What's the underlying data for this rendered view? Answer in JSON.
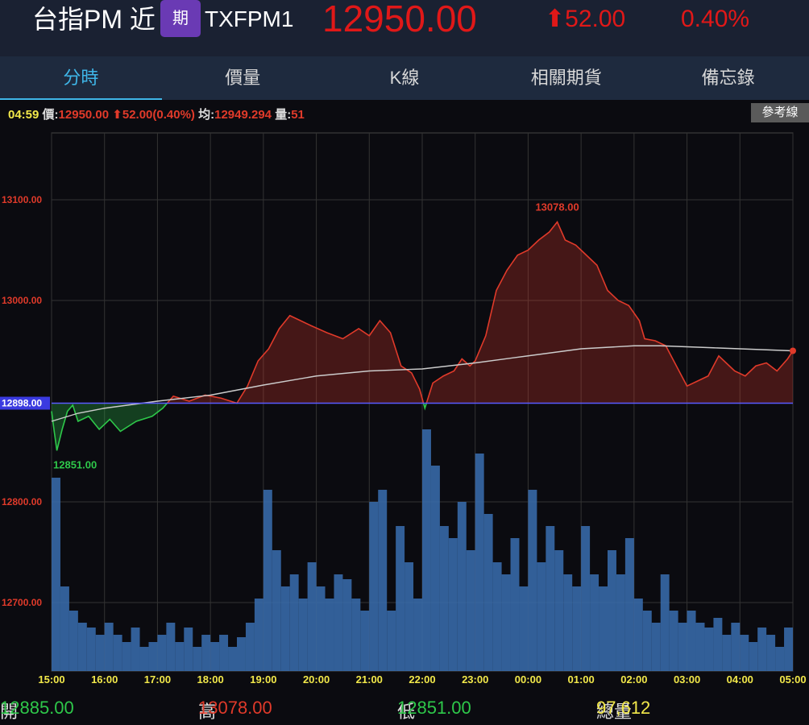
{
  "header": {
    "name": "台指PM 近",
    "badge": "期",
    "code": "TXFPM1",
    "price": "12950.00",
    "change": "52.00",
    "change_pct": "0.40%",
    "arrow_icon": "arrow-up-icon"
  },
  "tabs": [
    "分時",
    "價量",
    "K線",
    "相關期貨",
    "備忘錄"
  ],
  "info": {
    "time": "04:59",
    "price_label": "價:",
    "price": "12950.00",
    "change": "⬆52.00(0.40%)",
    "avg_label": "均:",
    "avg": "12949.294",
    "vol_label": "量:",
    "vol": "51"
  },
  "ref_button": "參考線",
  "footer": {
    "open_label": "開",
    "open": "12885.00",
    "high_label": "高",
    "high": "13078.00",
    "low_label": "低",
    "low": "12851.00",
    "vol_label": "總量",
    "vol": "97,612"
  },
  "colors": {
    "up": "#e03a2a",
    "down": "#2ec84a",
    "volume": "#3a6fb0",
    "avg": "#cccccc",
    "ref": "#5a5aff"
  },
  "chart_data": {
    "type": "line",
    "reference": 12898,
    "reference_label": "12898.00",
    "ylim": [
      12633,
      13165
    ],
    "y_ticks": [
      {
        "v": 13100,
        "label": "13100.00"
      },
      {
        "v": 13000,
        "label": "13000.00"
      },
      {
        "v": 12800,
        "label": "12800.00"
      },
      {
        "v": 12700,
        "label": "12700.00"
      }
    ],
    "x_ticks": [
      "15:00",
      "16:00",
      "17:00",
      "18:00",
      "19:00",
      "20:00",
      "21:00",
      "22:00",
      "23:00",
      "00:00",
      "01:00",
      "02:00",
      "03:00",
      "04:00",
      "05:00"
    ],
    "high_label": "13078.00",
    "low_label": "12851.00",
    "price": [
      [
        0,
        12890
      ],
      [
        0.05,
        12870
      ],
      [
        0.1,
        12851
      ],
      [
        0.2,
        12872
      ],
      [
        0.3,
        12890
      ],
      [
        0.4,
        12896
      ],
      [
        0.5,
        12880
      ],
      [
        0.7,
        12885
      ],
      [
        0.9,
        12872
      ],
      [
        1.1,
        12882
      ],
      [
        1.3,
        12870
      ],
      [
        1.6,
        12880
      ],
      [
        1.9,
        12885
      ],
      [
        2.1,
        12893
      ],
      [
        2.3,
        12905
      ],
      [
        2.6,
        12900
      ],
      [
        2.9,
        12906
      ],
      [
        3.2,
        12903
      ],
      [
        3.5,
        12898
      ],
      [
        3.7,
        12915
      ],
      [
        3.9,
        12940
      ],
      [
        4.1,
        12952
      ],
      [
        4.3,
        12972
      ],
      [
        4.5,
        12985
      ],
      [
        4.7,
        12980
      ],
      [
        4.9,
        12975
      ],
      [
        5.2,
        12968
      ],
      [
        5.5,
        12962
      ],
      [
        5.8,
        12972
      ],
      [
        6.0,
        12965
      ],
      [
        6.2,
        12980
      ],
      [
        6.4,
        12968
      ],
      [
        6.6,
        12935
      ],
      [
        6.8,
        12928
      ],
      [
        6.95,
        12912
      ],
      [
        7.05,
        12893
      ],
      [
        7.2,
        12918
      ],
      [
        7.4,
        12925
      ],
      [
        7.6,
        12930
      ],
      [
        7.75,
        12942
      ],
      [
        7.9,
        12935
      ],
      [
        8.0,
        12940
      ],
      [
        8.2,
        12965
      ],
      [
        8.4,
        13010
      ],
      [
        8.6,
        13030
      ],
      [
        8.8,
        13045
      ],
      [
        9.0,
        13050
      ],
      [
        9.2,
        13060
      ],
      [
        9.4,
        13068
      ],
      [
        9.55,
        13078
      ],
      [
        9.7,
        13060
      ],
      [
        9.9,
        13055
      ],
      [
        10.1,
        13045
      ],
      [
        10.3,
        13035
      ],
      [
        10.5,
        13010
      ],
      [
        10.7,
        13000
      ],
      [
        10.9,
        12995
      ],
      [
        11.1,
        12980
      ],
      [
        11.2,
        12962
      ],
      [
        11.4,
        12960
      ],
      [
        11.6,
        12955
      ],
      [
        11.75,
        12940
      ],
      [
        11.9,
        12925
      ],
      [
        12.0,
        12915
      ],
      [
        12.2,
        12920
      ],
      [
        12.4,
        12925
      ],
      [
        12.6,
        12945
      ],
      [
        12.8,
        12935
      ],
      [
        12.9,
        12930
      ],
      [
        13.1,
        12925
      ],
      [
        13.3,
        12935
      ],
      [
        13.5,
        12938
      ],
      [
        13.7,
        12930
      ],
      [
        13.9,
        12942
      ],
      [
        14.0,
        12950
      ]
    ],
    "average": [
      [
        0,
        12880
      ],
      [
        0.5,
        12888
      ],
      [
        1,
        12893
      ],
      [
        2,
        12900
      ],
      [
        3,
        12906
      ],
      [
        4,
        12916
      ],
      [
        5,
        12925
      ],
      [
        6,
        12930
      ],
      [
        7,
        12932
      ],
      [
        8,
        12938
      ],
      [
        9,
        12945
      ],
      [
        10,
        12952
      ],
      [
        11,
        12955
      ],
      [
        11.5,
        12955
      ],
      [
        12.5,
        12953
      ],
      [
        14,
        12950
      ]
    ],
    "volume": [
      80,
      35,
      25,
      20,
      18,
      15,
      20,
      15,
      12,
      18,
      10,
      12,
      15,
      20,
      12,
      18,
      10,
      15,
      12,
      15,
      10,
      14,
      20,
      30,
      75,
      50,
      35,
      40,
      30,
      45,
      35,
      30,
      40,
      38,
      30,
      25,
      70,
      75,
      25,
      60,
      45,
      30,
      100,
      85,
      60,
      55,
      70,
      50,
      90,
      65,
      45,
      40,
      55,
      35,
      75,
      45,
      60,
      50,
      40,
      35,
      60,
      40,
      35,
      50,
      40,
      55,
      30,
      25,
      20,
      40,
      25,
      20,
      25,
      20,
      18,
      22,
      15,
      20,
      15,
      12,
      18,
      15,
      10,
      18
    ]
  }
}
